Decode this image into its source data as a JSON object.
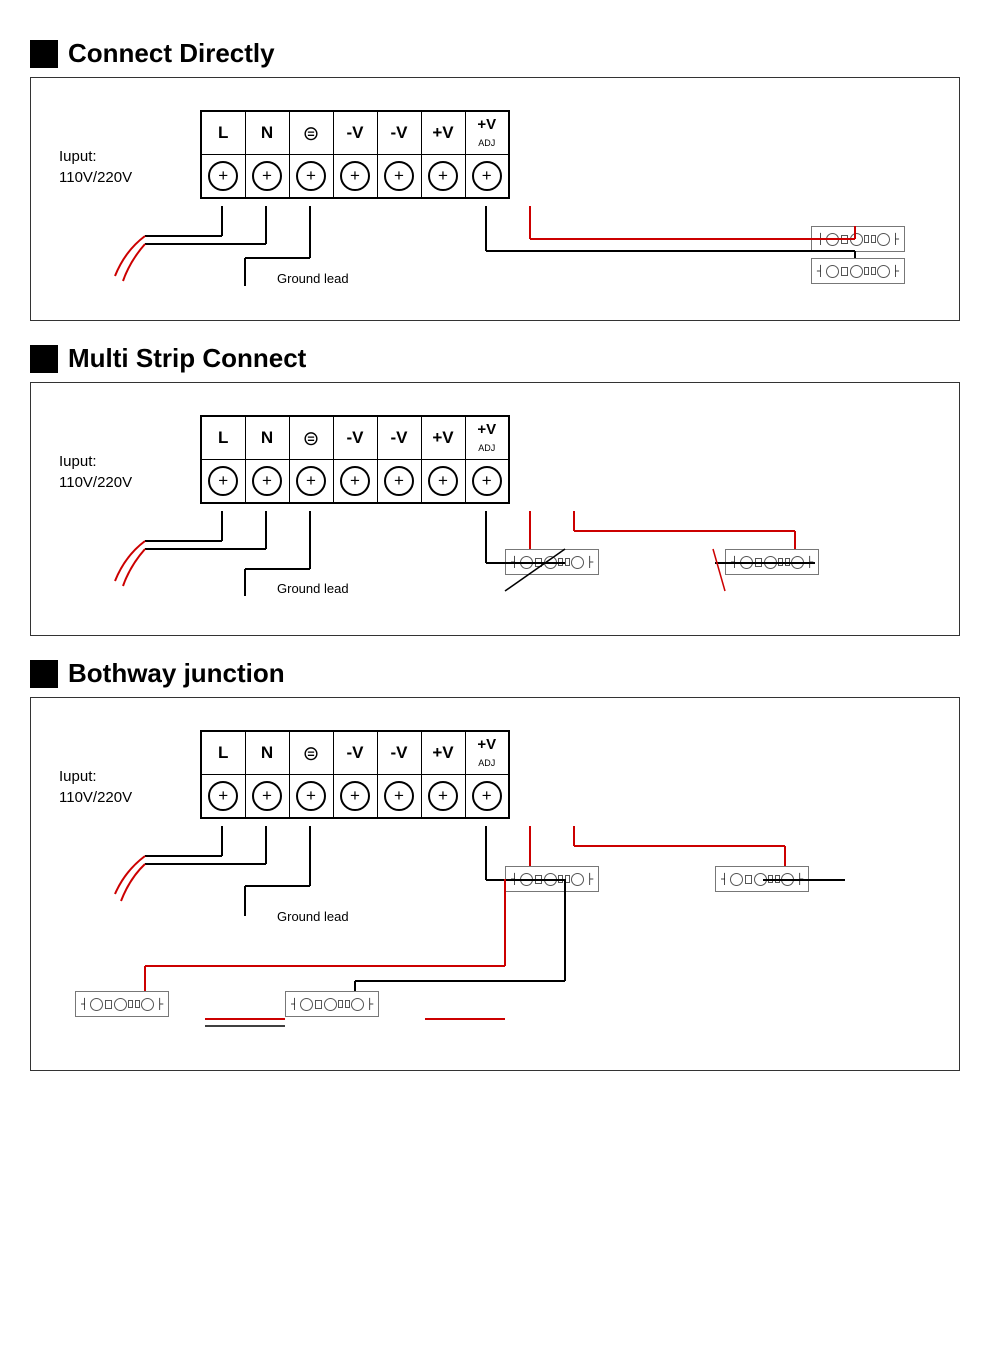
{
  "sections": [
    {
      "id": "connect-directly",
      "title": "Connect Directly",
      "ground_lead": "Ground lead",
      "input_label": "Iuput:\n110V/220V"
    },
    {
      "id": "multi-strip-connect",
      "title": "Multi Strip Connect",
      "ground_lead": "Ground lead",
      "input_label": "Iuput:\n110V/220V"
    },
    {
      "id": "bothway-junction",
      "title": "Bothway junction",
      "ground_lead": "Ground lead",
      "input_label": "Iuput:\n110V/220V"
    }
  ],
  "terminal": {
    "labels": [
      "L",
      "N",
      "⊜",
      "-V",
      "-V",
      "+V",
      "+V +V"
    ],
    "adj_label": "ADJ"
  }
}
